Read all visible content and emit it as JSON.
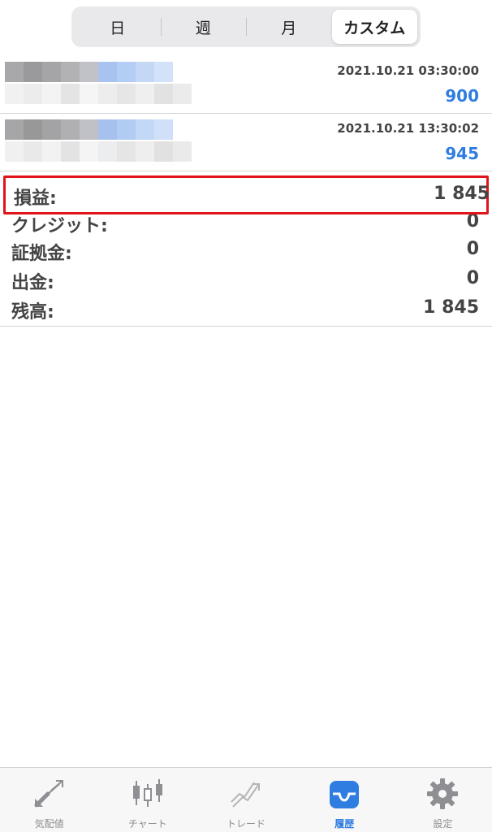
{
  "tabs_period": {
    "items": [
      {
        "label": "日"
      },
      {
        "label": "週"
      },
      {
        "label": "月"
      },
      {
        "label": "カスタム",
        "active": true
      }
    ]
  },
  "deals": [
    {
      "time": "2021.10.21 03:30:00",
      "amount": "900"
    },
    {
      "time": "2021.10.21 13:30:02",
      "amount": "945"
    }
  ],
  "summary": {
    "profit": {
      "label": "損益:",
      "value": "1 845"
    },
    "credit": {
      "label": "クレジット:",
      "value": "0"
    },
    "deposit": {
      "label": "証拠金:",
      "value": "0"
    },
    "withdrawal": {
      "label": "出金:",
      "value": "0"
    },
    "balance": {
      "label": "残高:",
      "value": "1 845"
    }
  },
  "tabbar": {
    "items": [
      {
        "label": "気配値",
        "icon": "quotes-arrows-icon"
      },
      {
        "label": "チャート",
        "icon": "candlestick-chart-icon"
      },
      {
        "label": "トレード",
        "icon": "trade-trend-icon"
      },
      {
        "label": "履歴",
        "icon": "inbox-history-icon",
        "active": true
      },
      {
        "label": "設定",
        "icon": "gear-icon"
      }
    ]
  },
  "colors": {
    "accent": "#2f7de1",
    "highlight_border": "#e0151b",
    "inactive_icon": "#8e8e93"
  }
}
